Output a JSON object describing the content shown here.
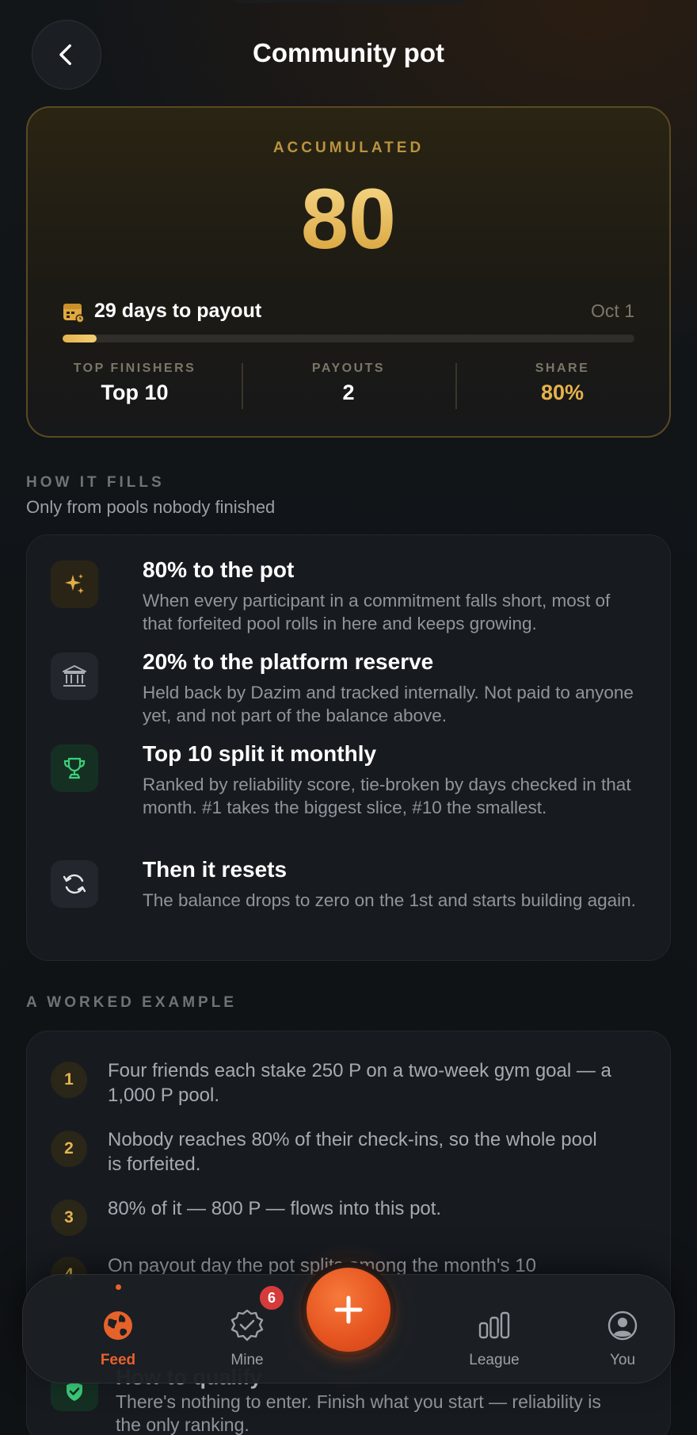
{
  "header": {
    "title": "Community pot",
    "back_icon": "chevron-left-icon"
  },
  "pot": {
    "label": "ACCUMULATED",
    "amount": "80",
    "days_to_payout": "29 days to payout",
    "payout_date": "Oct 1",
    "progress_fraction": 0.06,
    "stats": [
      {
        "label": "TOP FINISHERS",
        "value": "Top 10"
      },
      {
        "label": "PAYOUTS",
        "value": "2"
      },
      {
        "label": "SHARE",
        "value": "80%"
      }
    ]
  },
  "how_it_fills": {
    "heading": "HOW IT FILLS",
    "subheading": "Only from pools nobody finished",
    "items": [
      {
        "icon": "sparkle-icon",
        "title": "80% to the pot",
        "desc": "When every participant in a commitment falls short, most of that forfeited pool rolls in here and keeps growing."
      },
      {
        "icon": "bank-icon",
        "title": "20% to the platform reserve",
        "desc": "Held back by Dazim and tracked internally. Not paid to anyone yet, and not part of the balance above."
      },
      {
        "icon": "trophy-icon",
        "title": "Top 10 split it monthly",
        "desc": "Ranked by reliability score, tie-broken by days checked in that month. #1 takes the biggest slice, #10 the smallest."
      },
      {
        "icon": "refresh-icon",
        "title": "Then it resets",
        "desc": "The balance drops to zero on the 1st and starts building again."
      }
    ]
  },
  "worked_example": {
    "heading": "A WORKED EXAMPLE",
    "steps": [
      {
        "num": "1",
        "text": "Four friends each stake 250 P on a two-week gym goal — a 1,000 P pool."
      },
      {
        "num": "2",
        "text": "Nobody reaches 80% of their check-ins, so the whole pool is forfeited."
      },
      {
        "num": "3",
        "text": "80% of it — 800 P — flows into this pot."
      },
      {
        "num": "4",
        "text": "On payout day the pot splits among the month's 10"
      }
    ]
  },
  "qualify": {
    "title": "How to qualify",
    "text": "There's nothing to enter. Finish what you start — reliability is the only ranking."
  },
  "nav": {
    "items": [
      {
        "label": "Feed",
        "icon": "globe-icon",
        "active": true
      },
      {
        "label": "Mine",
        "icon": "verified-badge-icon",
        "badge": "6"
      },
      {
        "label": "League",
        "icon": "bar-chart-icon"
      },
      {
        "label": "You",
        "icon": "user-circle-icon"
      }
    ],
    "fab_icon": "plus-icon"
  },
  "colors": {
    "accent_gold": "#e6b24c",
    "accent_orange": "#e6622a",
    "badge_red": "#d63b3b"
  }
}
